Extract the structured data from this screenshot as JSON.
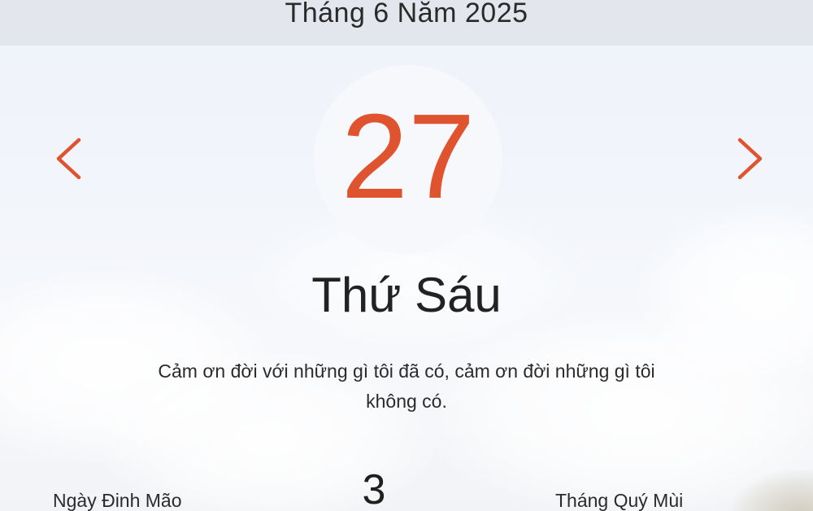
{
  "header": {
    "month_year": "Tháng 6 Năm 2025"
  },
  "navigation": {
    "prev_icon": "chevron-left-icon",
    "next_icon": "chevron-right-icon",
    "accent_color": "#e0532f"
  },
  "day": {
    "number": "27",
    "weekday": "Thứ Sáu"
  },
  "quote": {
    "line1": "Cảm ơn đời với những gì tôi đã có, cảm ơn đời những gì tôi",
    "line2": "không có."
  },
  "lunar": {
    "day_label": "Ngày Đinh Mão",
    "day_number": "3",
    "month_label": "Tháng Quý Mùi"
  }
}
